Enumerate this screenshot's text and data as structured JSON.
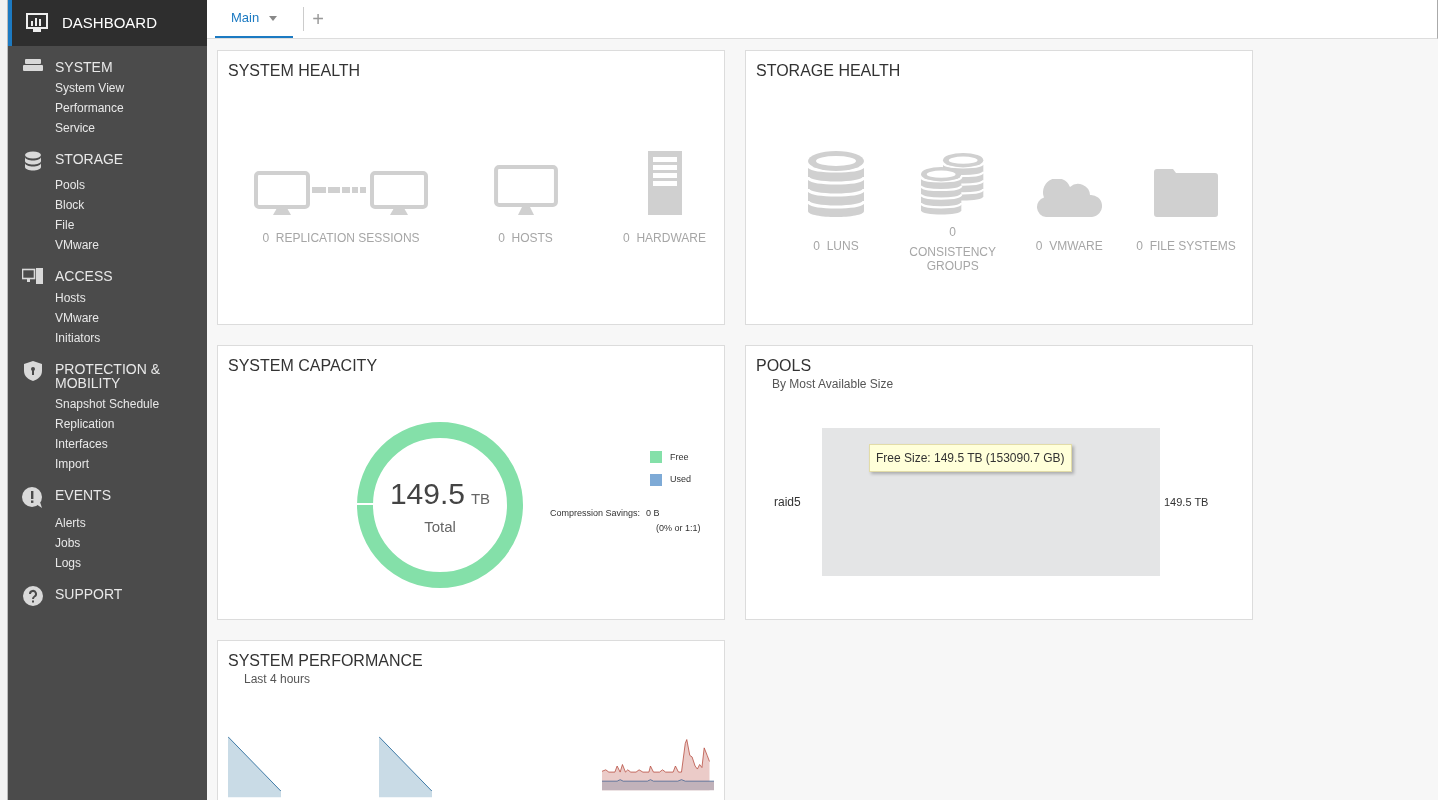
{
  "sidebar": {
    "dashboard": {
      "label": "DASHBOARD",
      "selected": true
    },
    "sections": [
      {
        "title": "SYSTEM",
        "items": [
          "System View",
          "Performance",
          "Service"
        ]
      },
      {
        "title": "STORAGE",
        "items": [
          "Pools",
          "Block",
          "File",
          "VMware"
        ]
      },
      {
        "title": "ACCESS",
        "items": [
          "Hosts",
          "VMware",
          "Initiators"
        ]
      },
      {
        "title": "PROTECTION & MOBILITY",
        "items": [
          "Snapshot Schedule",
          "Replication",
          "Interfaces",
          "Import"
        ]
      },
      {
        "title": "EVENTS",
        "items": [
          "Alerts",
          "Jobs",
          "Logs"
        ]
      },
      {
        "title": "SUPPORT"
      }
    ]
  },
  "tabs": [
    {
      "label": "Main",
      "selected": true
    }
  ],
  "add_tab": "+",
  "system_health": {
    "title": "SYSTEM HEALTH",
    "items": [
      {
        "count": "0",
        "label": "REPLICATION SESSIONS"
      },
      {
        "count": "0",
        "label": "HOSTS"
      },
      {
        "count": "0",
        "label": "HARDWARE"
      }
    ]
  },
  "storage_health": {
    "title": "STORAGE HEALTH",
    "items": [
      {
        "count": "0",
        "label": "LUNS",
        "kind": "inline"
      },
      {
        "count": "0",
        "label": "CONSISTENCY GROUPS",
        "kind": "stacked"
      },
      {
        "count": "0",
        "label": "VMWARE",
        "kind": "inline"
      },
      {
        "count": "0",
        "label": "FILE SYSTEMS",
        "kind": "inline"
      }
    ]
  },
  "system_capacity": {
    "title": "SYSTEM CAPACITY",
    "total": "149.5",
    "unit": "TB",
    "total_label": "Total",
    "legend": [
      {
        "label": "Free",
        "color": "#84e0a9"
      },
      {
        "label": "Used",
        "color": "#7eaad6"
      }
    ],
    "savings_label": "Compression Savings:",
    "savings_value": "0 B",
    "savings_ratio": "(0% or 1:1)"
  },
  "pools": {
    "title": "POOLS",
    "subtitle": "By Most Available Size",
    "tooltip": "Free Size: 149.5 TB (153090.7 GB)",
    "bars": [
      {
        "label": "raid5",
        "value_label": "149.5 TB"
      }
    ]
  },
  "system_performance": {
    "title": "SYSTEM PERFORMANCE",
    "subtitle": "Last 4 hours"
  }
}
